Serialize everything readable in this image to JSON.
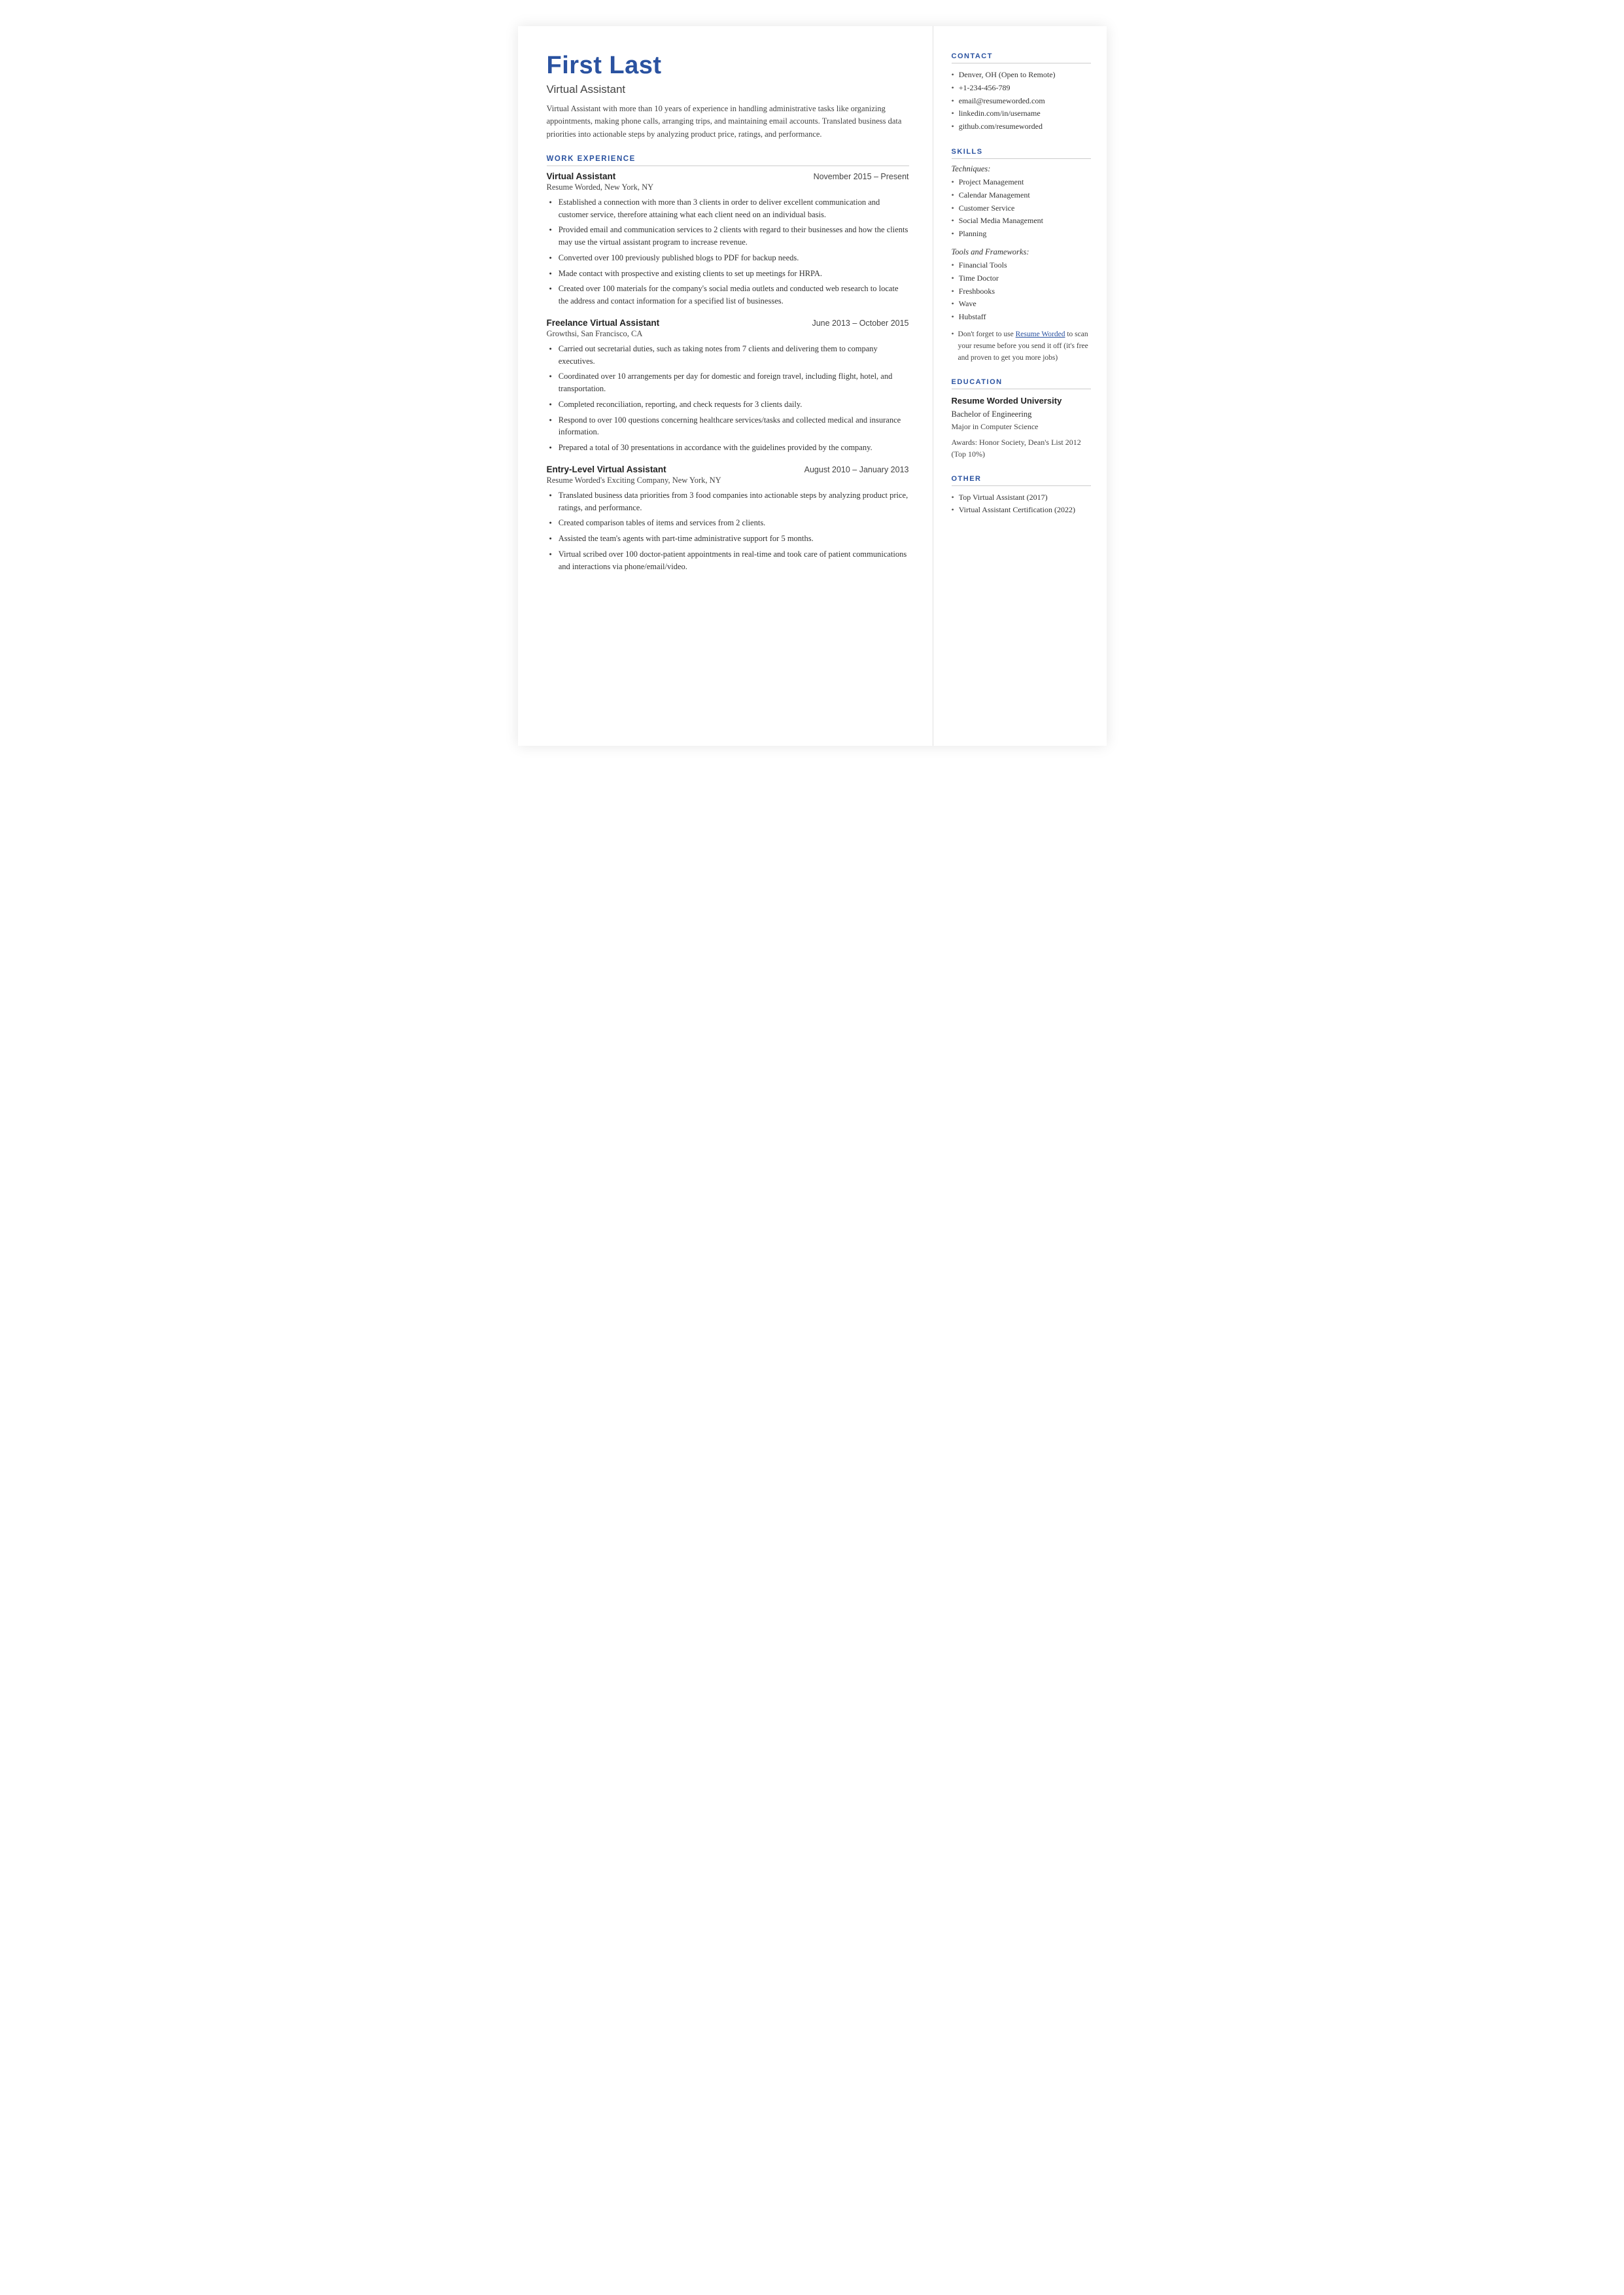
{
  "header": {
    "name": "First Last",
    "title": "Virtual Assistant",
    "summary": "Virtual Assistant with more than 10 years of experience in handling administrative tasks like organizing appointments, making phone calls, arranging trips, and maintaining email accounts. Translated business data priorities into actionable steps by analyzing product price, ratings, and performance."
  },
  "sections": {
    "work_experience_label": "WORK EXPERIENCE",
    "jobs": [
      {
        "title": "Virtual Assistant",
        "dates": "November 2015 – Present",
        "company": "Resume Worded, New York, NY",
        "bullets": [
          "Established a connection with more than 3 clients in order to deliver excellent communication and customer service, therefore attaining what each client need on an individual basis.",
          "Provided email and communication services to 2 clients with regard to their businesses and how the clients may use the virtual assistant program to increase revenue.",
          "Converted over 100 previously published blogs to PDF for backup needs.",
          "Made contact with prospective and existing clients to set up meetings for HRPA.",
          "Created over 100 materials for the company's social media outlets and conducted web research to locate the address and contact information for a specified list of businesses."
        ]
      },
      {
        "title": "Freelance Virtual Assistant",
        "dates": "June 2013 – October 2015",
        "company": "Growthsi, San Francisco, CA",
        "bullets": [
          "Carried out secretarial duties, such as taking notes from 7 clients and delivering them to company executives.",
          "Coordinated over 10 arrangements per day for domestic and foreign travel, including flight, hotel, and transportation.",
          "Completed reconciliation, reporting, and check requests for 3 clients daily.",
          "Respond to over 100 questions concerning healthcare services/tasks and collected medical and insurance information.",
          "Prepared a total of 30 presentations in accordance with the guidelines provided by the company."
        ]
      },
      {
        "title": "Entry-Level Virtual Assistant",
        "dates": "August 2010 – January 2013",
        "company": "Resume Worded's Exciting Company, New York, NY",
        "bullets": [
          "Translated business data priorities from 3 food companies into actionable steps by analyzing product price, ratings, and performance.",
          "Created comparison tables of items and services from 2 clients.",
          "Assisted the team's agents with part-time administrative support for 5 months.",
          "Virtual scribed over 100 doctor-patient appointments in real-time and took care of patient communications and interactions via phone/email/video."
        ]
      }
    ]
  },
  "sidebar": {
    "contact_label": "CONTACT",
    "contact_items": [
      "Denver, OH (Open to Remote)",
      "+1-234-456-789",
      "email@resumeworded.com",
      "linkedin.com/in/username",
      "github.com/resumeworded"
    ],
    "skills_label": "SKILLS",
    "techniques_label": "Techniques:",
    "techniques": [
      "Project Management",
      "Calendar Management",
      "Customer Service",
      "Social Media Management",
      "Planning"
    ],
    "tools_label": "Tools and Frameworks:",
    "tools": [
      "Financial Tools",
      "Time Doctor",
      "Freshbooks",
      "Wave",
      "Hubstaff"
    ],
    "skills_note_prefix": "Don't forget to use ",
    "skills_note_link_text": "Resume Worded",
    "skills_note_suffix": " to scan your resume before you send it off (it's free and proven to get you more jobs)",
    "education_label": "EDUCATION",
    "edu_school": "Resume Worded University",
    "edu_degree": "Bachelor of Engineering",
    "edu_major": "Major in Computer Science",
    "edu_awards": "Awards: Honor Society, Dean's List 2012 (Top 10%)",
    "other_label": "OTHER",
    "other_items": [
      "Top Virtual Assistant (2017)",
      "Virtual Assistant Certification (2022)"
    ]
  }
}
